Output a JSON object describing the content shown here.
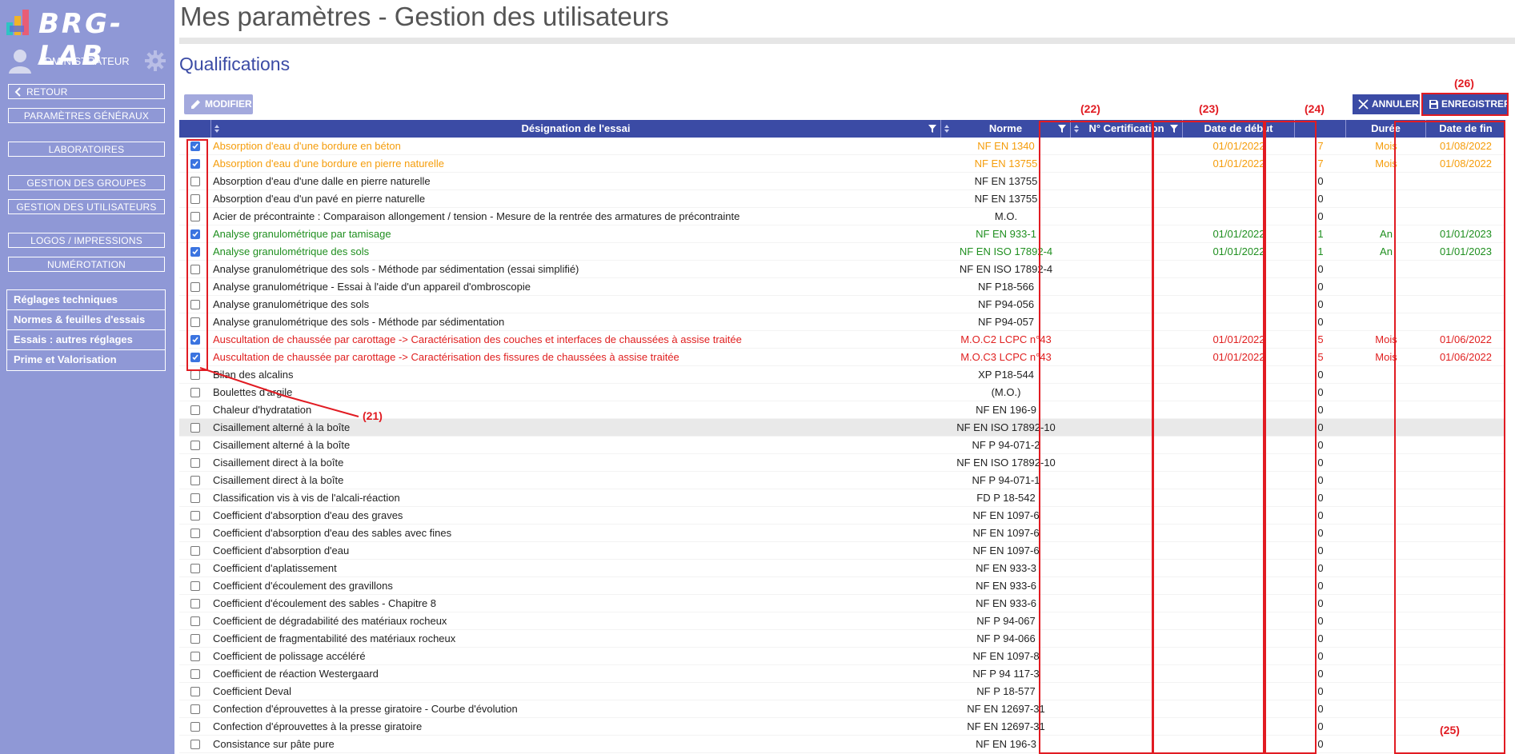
{
  "app": {
    "logo_text": "BRG-LAB",
    "user_name": "ADMINISTRATEUR"
  },
  "sidebar": {
    "back": "RETOUR",
    "buttons": [
      "PARAMÈTRES GÉNÉRAUX",
      "LABORATOIRES",
      "GESTION DES GROUPES",
      "GESTION DES UTILISATEURS",
      "LOGOS / IMPRESSIONS",
      "NUMÉROTATION"
    ],
    "tech_menu": [
      "Réglages techniques",
      "Normes & feuilles d'essais",
      "Essais : autres réglages",
      "Prime et Valorisation"
    ]
  },
  "page": {
    "title": "Mes paramètres - Gestion des utilisateurs",
    "section": "Qualifications",
    "modify_label": "MODIFIER",
    "cancel_label": "ANNULER",
    "save_label": "ENREGISTRER"
  },
  "table": {
    "headers": {
      "designation": "Désignation de l'essai",
      "norme": "Norme",
      "certification": "N° Certification",
      "date_debut": "Date de début",
      "n": "",
      "duree": "Durée",
      "date_fin": "Date de fin"
    },
    "rows": [
      {
        "checked": true,
        "status": "orange",
        "designation": "Absorption d'eau d'une bordure en béton",
        "norme": "NF EN 1340",
        "cert": "",
        "debut": "01/01/2022",
        "n": "7",
        "duree": "Mois",
        "fin": "01/08/2022"
      },
      {
        "checked": true,
        "status": "orange",
        "designation": "Absorption d'eau d'une bordure en pierre naturelle",
        "norme": "NF EN 13755",
        "cert": "",
        "debut": "01/01/2022",
        "n": "7",
        "duree": "Mois",
        "fin": "01/08/2022"
      },
      {
        "checked": false,
        "status": "",
        "designation": "Absorption d'eau d'une dalle en pierre naturelle",
        "norme": "NF EN 13755",
        "cert": "",
        "debut": "",
        "n": "0",
        "duree": "",
        "fin": ""
      },
      {
        "checked": false,
        "status": "",
        "designation": "Absorption d'eau d'un pavé en pierre naturelle",
        "norme": "NF EN 13755",
        "cert": "",
        "debut": "",
        "n": "0",
        "duree": "",
        "fin": ""
      },
      {
        "checked": false,
        "status": "",
        "designation": "Acier de précontrainte : Comparaison allongement / tension - Mesure de la rentrée des armatures de précontrainte",
        "norme": "M.O.",
        "cert": "",
        "debut": "",
        "n": "0",
        "duree": "",
        "fin": ""
      },
      {
        "checked": true,
        "status": "green",
        "designation": "Analyse granulométrique par tamisage",
        "norme": "NF EN 933-1",
        "cert": "",
        "debut": "01/01/2022",
        "n": "1",
        "duree": "An",
        "fin": "01/01/2023"
      },
      {
        "checked": true,
        "status": "green",
        "designation": "Analyse granulométrique des sols",
        "norme": "NF EN ISO 17892-4",
        "cert": "",
        "debut": "01/01/2022",
        "n": "1",
        "duree": "An",
        "fin": "01/01/2023"
      },
      {
        "checked": false,
        "status": "",
        "designation": "Analyse granulométrique des sols - Méthode par sédimentation (essai simplifié)",
        "norme": "NF EN ISO 17892-4",
        "cert": "",
        "debut": "",
        "n": "0",
        "duree": "",
        "fin": ""
      },
      {
        "checked": false,
        "status": "",
        "designation": "Analyse granulométrique - Essai à l'aide d'un appareil d'ombroscopie",
        "norme": "NF P18-566",
        "cert": "",
        "debut": "",
        "n": "0",
        "duree": "",
        "fin": ""
      },
      {
        "checked": false,
        "status": "",
        "designation": "Analyse granulométrique des sols",
        "norme": "NF P94-056",
        "cert": "",
        "debut": "",
        "n": "0",
        "duree": "",
        "fin": ""
      },
      {
        "checked": false,
        "status": "",
        "designation": "Analyse granulométrique des sols - Méthode par sédimentation",
        "norme": "NF P94-057",
        "cert": "",
        "debut": "",
        "n": "0",
        "duree": "",
        "fin": ""
      },
      {
        "checked": true,
        "status": "red",
        "designation": "Auscultation de chaussée par carottage -> Caractérisation des couches et interfaces de chaussées à assise traitée",
        "norme": "M.O.C2 LCPC n°43",
        "cert": "",
        "debut": "01/01/2022",
        "n": "5",
        "duree": "Mois",
        "fin": "01/06/2022"
      },
      {
        "checked": true,
        "status": "red",
        "designation": "Auscultation de chaussée par carottage -> Caractérisation des fissures de chaussées à assise traitée",
        "norme": "M.O.C3 LCPC n°43",
        "cert": "",
        "debut": "01/01/2022",
        "n": "5",
        "duree": "Mois",
        "fin": "01/06/2022"
      },
      {
        "checked": false,
        "status": "",
        "designation": "Bilan des alcalins",
        "norme": "XP P18-544",
        "cert": "",
        "debut": "",
        "n": "0",
        "duree": "",
        "fin": ""
      },
      {
        "checked": false,
        "status": "",
        "designation": "Boulettes d'argile",
        "norme": "(M.O.)",
        "cert": "",
        "debut": "",
        "n": "0",
        "duree": "",
        "fin": ""
      },
      {
        "checked": false,
        "status": "",
        "designation": "Chaleur d'hydratation",
        "norme": "NF EN 196-9",
        "cert": "",
        "debut": "",
        "n": "0",
        "duree": "",
        "fin": ""
      },
      {
        "checked": false,
        "status": "",
        "hl": true,
        "designation": "Cisaillement alterné à la boîte",
        "norme": "NF EN ISO 17892-10",
        "cert": "",
        "debut": "",
        "n": "0",
        "duree": "",
        "fin": ""
      },
      {
        "checked": false,
        "status": "",
        "designation": "Cisaillement alterné à la boîte",
        "norme": "NF P 94-071-2",
        "cert": "",
        "debut": "",
        "n": "0",
        "duree": "",
        "fin": ""
      },
      {
        "checked": false,
        "status": "",
        "designation": "Cisaillement direct à la boîte",
        "norme": "NF EN ISO 17892-10",
        "cert": "",
        "debut": "",
        "n": "0",
        "duree": "",
        "fin": ""
      },
      {
        "checked": false,
        "status": "",
        "designation": "Cisaillement direct à la boîte",
        "norme": "NF P 94-071-1",
        "cert": "",
        "debut": "",
        "n": "0",
        "duree": "",
        "fin": ""
      },
      {
        "checked": false,
        "status": "",
        "designation": "Classification vis à vis de l'alcali-réaction",
        "norme": "FD P 18-542",
        "cert": "",
        "debut": "",
        "n": "0",
        "duree": "",
        "fin": ""
      },
      {
        "checked": false,
        "status": "",
        "designation": "Coefficient d'absorption d'eau des graves",
        "norme": "NF EN 1097-6",
        "cert": "",
        "debut": "",
        "n": "0",
        "duree": "",
        "fin": ""
      },
      {
        "checked": false,
        "status": "",
        "designation": "Coefficient d'absorption d'eau des sables avec fines",
        "norme": "NF EN 1097-6",
        "cert": "",
        "debut": "",
        "n": "0",
        "duree": "",
        "fin": ""
      },
      {
        "checked": false,
        "status": "",
        "designation": "Coefficient d'absorption d'eau",
        "norme": "NF EN 1097-6",
        "cert": "",
        "debut": "",
        "n": "0",
        "duree": "",
        "fin": ""
      },
      {
        "checked": false,
        "status": "",
        "designation": "Coefficient d'aplatissement",
        "norme": "NF EN 933-3",
        "cert": "",
        "debut": "",
        "n": "0",
        "duree": "",
        "fin": ""
      },
      {
        "checked": false,
        "status": "",
        "designation": "Coefficient d'écoulement des gravillons",
        "norme": "NF EN 933-6",
        "cert": "",
        "debut": "",
        "n": "0",
        "duree": "",
        "fin": ""
      },
      {
        "checked": false,
        "status": "",
        "designation": "Coefficient d'écoulement des sables - Chapitre 8",
        "norme": "NF EN 933-6",
        "cert": "",
        "debut": "",
        "n": "0",
        "duree": "",
        "fin": ""
      },
      {
        "checked": false,
        "status": "",
        "designation": "Coefficient de dégradabilité des matériaux rocheux",
        "norme": "NF P 94-067",
        "cert": "",
        "debut": "",
        "n": "0",
        "duree": "",
        "fin": ""
      },
      {
        "checked": false,
        "status": "",
        "designation": "Coefficient de fragmentabilité des matériaux rocheux",
        "norme": "NF P 94-066",
        "cert": "",
        "debut": "",
        "n": "0",
        "duree": "",
        "fin": ""
      },
      {
        "checked": false,
        "status": "",
        "designation": "Coefficient de polissage accéléré",
        "norme": "NF EN 1097-8",
        "cert": "",
        "debut": "",
        "n": "0",
        "duree": "",
        "fin": ""
      },
      {
        "checked": false,
        "status": "",
        "designation": "Coefficient de réaction Westergaard",
        "norme": "NF P 94 117-3",
        "cert": "",
        "debut": "",
        "n": "0",
        "duree": "",
        "fin": ""
      },
      {
        "checked": false,
        "status": "",
        "designation": "Coefficient Deval",
        "norme": "NF P 18-577",
        "cert": "",
        "debut": "",
        "n": "0",
        "duree": "",
        "fin": ""
      },
      {
        "checked": false,
        "status": "",
        "designation": "Confection d'éprouvettes à la presse giratoire - Courbe d'évolution",
        "norme": "NF EN 12697-31",
        "cert": "",
        "debut": "",
        "n": "0",
        "duree": "",
        "fin": ""
      },
      {
        "checked": false,
        "status": "",
        "designation": "Confection d'éprouvettes à la presse giratoire",
        "norme": "NF EN 12697-31",
        "cert": "",
        "debut": "",
        "n": "0",
        "duree": "",
        "fin": ""
      },
      {
        "checked": false,
        "status": "",
        "designation": "Consistance sur pâte pure",
        "norme": "NF EN 196-3",
        "cert": "",
        "debut": "",
        "n": "0",
        "duree": "",
        "fin": ""
      }
    ]
  },
  "annotations": {
    "a21": "(21)",
    "a22": "(22)",
    "a23": "(23)",
    "a24": "(24)",
    "a25": "(25)",
    "a26": "(26)"
  },
  "colors": {
    "accent": "#3b4ba5",
    "sidebar": "#8f98d6",
    "orange": "#f59d0b",
    "green": "#1f8f1f",
    "red": "#e02020",
    "annotation": "#e11b22"
  }
}
